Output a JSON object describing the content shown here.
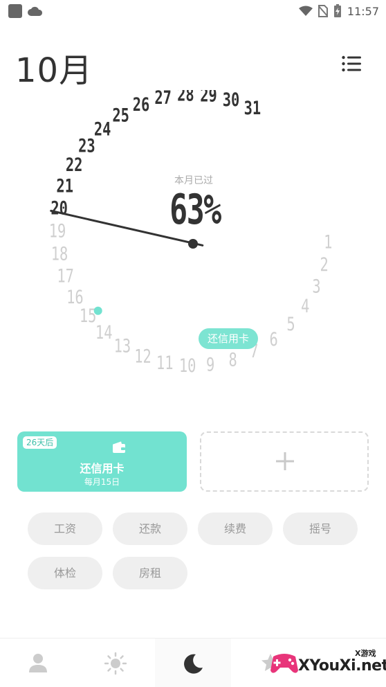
{
  "status_bar": {
    "time": "11:57"
  },
  "header": {
    "month": "10月"
  },
  "dial": {
    "caption": "本月已过",
    "percent": "63%",
    "days": [
      "1",
      "2",
      "3",
      "4",
      "5",
      "6",
      "7",
      "8",
      "9",
      "10",
      "11",
      "12",
      "13",
      "14",
      "15",
      "16",
      "17",
      "18",
      "19",
      "20",
      "21",
      "22",
      "23",
      "24",
      "25",
      "26",
      "27",
      "28",
      "29",
      "30",
      "31"
    ],
    "current_day": 20,
    "event_day": 15,
    "event_tag": "还信用卡"
  },
  "cards": {
    "event": {
      "countdown": "26天后",
      "icon": "wallet-icon",
      "name": "还信用卡",
      "schedule": "每月15日"
    },
    "add": {
      "icon": "plus-icon"
    }
  },
  "tags": [
    "工资",
    "还款",
    "续费",
    "摇号",
    "体检",
    "房租"
  ],
  "bottom_nav": [
    {
      "icon": "person-icon"
    },
    {
      "icon": "sun-icon"
    },
    {
      "icon": "moon-icon"
    },
    {
      "icon": "star-icon"
    }
  ],
  "watermark": {
    "logo": "gamepad-logo",
    "text": "XYouXi.net",
    "small": "X游戏"
  },
  "colors": {
    "accent": "#72e2d0",
    "dark": "#333333",
    "faded": "#cfcfcf",
    "pill": "#efefef"
  }
}
